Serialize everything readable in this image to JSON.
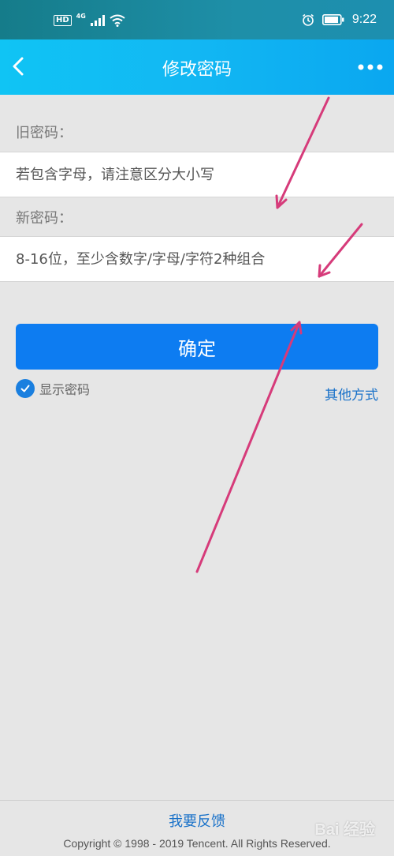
{
  "status_bar": {
    "hd": "HD",
    "network": "4G",
    "time": "9:22",
    "icons": [
      "signal-icon",
      "wifi-icon",
      "alarm-icon",
      "battery-icon"
    ]
  },
  "header": {
    "title": "修改密码",
    "back_icon": "chevron-left-icon",
    "more_icon": "more-dots-icon"
  },
  "form": {
    "old_password": {
      "label": "旧密码：",
      "placeholder": "若包含字母，请注意区分大小写"
    },
    "new_password": {
      "label": "新密码：",
      "placeholder": "8-16位，至少含数字/字母/字符2种组合"
    },
    "confirm_label": "确定",
    "show_password_label": "显示密码",
    "show_password_checked": true,
    "other_methods_label": "其他方式"
  },
  "footer": {
    "feedback_label": "我要反馈",
    "copyright": "Copyright © 1998 - 2019 Tencent. All Rights Reserved."
  },
  "watermark": "Bai 经验",
  "colors": {
    "header_gradient_start": "#10c4f4",
    "header_gradient_end": "#0aa7f0",
    "primary_button": "#0d7cf1",
    "link": "#1a72c9",
    "annotation_arrow": "#d63b7a"
  }
}
